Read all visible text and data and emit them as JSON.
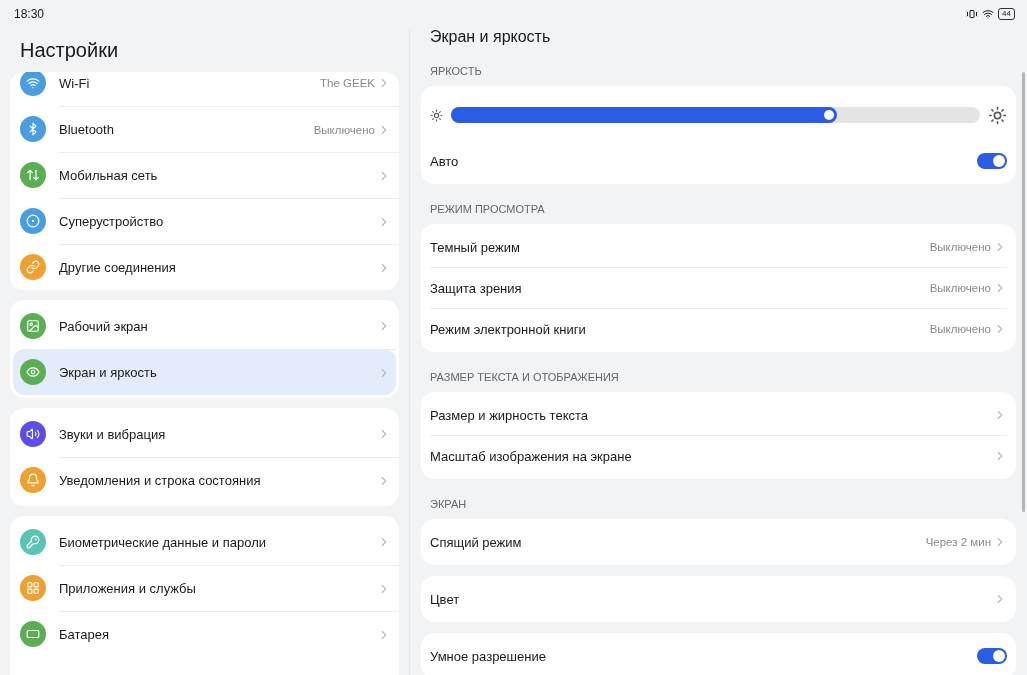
{
  "status_bar": {
    "time": "18:30",
    "battery": "44"
  },
  "sidebar": {
    "title": "Настройки",
    "groups": [
      {
        "items": [
          {
            "label": "Wi-Fi",
            "value": "The GEEK",
            "color": "#4a9de0",
            "selected": false
          },
          {
            "label": "Bluetooth",
            "value": "Выключено",
            "color": "#4a9de0",
            "selected": false
          },
          {
            "label": "Мобильная сеть",
            "color": "#5cae54",
            "selected": false
          },
          {
            "label": "Суперустройство",
            "color": "#4a9de0",
            "selected": false
          },
          {
            "label": "Другие соединения",
            "color": "#f0a030",
            "selected": false
          }
        ]
      },
      {
        "items": [
          {
            "label": "Рабочий экран",
            "color": "#5cae54",
            "selected": false
          },
          {
            "label": "Экран и яркость",
            "color": "#5cae54",
            "selected": true
          }
        ]
      },
      {
        "items": [
          {
            "label": "Звуки и вибрация",
            "color": "#5b4de6",
            "selected": false
          },
          {
            "label": "Уведомления и строка состояния",
            "color": "#f0a030",
            "selected": false
          }
        ]
      },
      {
        "items": [
          {
            "label": "Биометрические данные и пароли",
            "color": "#5cc4b4",
            "selected": false
          },
          {
            "label": "Приложения и службы",
            "color": "#f0a030",
            "selected": false
          },
          {
            "label": "Батарея",
            "color": "#5cae54",
            "selected": false
          }
        ]
      }
    ]
  },
  "detail": {
    "title": "Экран и яркость",
    "sections": [
      {
        "heading": "ЯРКОСТЬ",
        "cards": [
          {
            "rows": [
              {
                "kind": "slider",
                "level": 0.73
              },
              {
                "kind": "toggle",
                "label": "Авто",
                "on": true
              }
            ]
          }
        ]
      },
      {
        "heading": "РЕЖИМ ПРОСМОТРА",
        "cards": [
          {
            "rows": [
              {
                "kind": "link",
                "label": "Темный режим",
                "value": "Выключено"
              },
              {
                "kind": "link",
                "label": "Защита зрения",
                "value": "Выключено"
              },
              {
                "kind": "link",
                "label": "Режим электронной книги",
                "value": "Выключено"
              }
            ]
          }
        ]
      },
      {
        "heading": "РАЗМЕР ТЕКСТА И ОТОБРАЖЕНИЯ",
        "cards": [
          {
            "rows": [
              {
                "kind": "link",
                "label": "Размер и жирность текста"
              },
              {
                "kind": "link",
                "label": "Масштаб изображения на экране"
              }
            ]
          }
        ]
      },
      {
        "heading": "ЭКРАН",
        "cards": [
          {
            "rows": [
              {
                "kind": "link",
                "label": "Спящий режим",
                "value": "Через 2 мин"
              }
            ]
          },
          {
            "rows": [
              {
                "kind": "link",
                "label": "Цвет"
              }
            ]
          },
          {
            "rows": [
              {
                "kind": "toggle",
                "label": "Умное разрешение",
                "on": true
              }
            ]
          }
        ]
      }
    ]
  }
}
